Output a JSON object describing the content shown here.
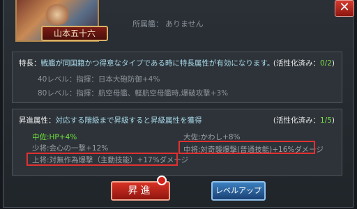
{
  "general": {
    "name": "山本五十六"
  },
  "affiliation": {
    "label": "所属艦：",
    "value": "ありません"
  },
  "trait": {
    "label": "特長：",
    "description": "戦艦が同国籍かつ得意なタイプである時に特長属性が有効になります。",
    "status_label": "(活性化済み：",
    "status_value": "0/2",
    "status_close": ")",
    "lines": [
      "40レベル：指揮：日本大砲防御+4%",
      "80レベル：指揮：航空母艦、軽航空母艦時,爆破攻撃+3%"
    ]
  },
  "promotion": {
    "label": "昇進属性：",
    "description": "対応する階級まで昇級すると昇級属性を獲得",
    "status_label": "(活性化済み：",
    "status_value": "1/5",
    "status_close": ")",
    "attributes": [
      "中佐:HP+4%",
      "大佐:かわし+8%",
      "少将:会心の一撃+12%",
      "中将:対奇襲爆撃(普通技能)+16%ダメージ",
      "上将:対無作為爆撃（主動技能）+17%ダメージ"
    ]
  },
  "buttons": {
    "promote": "昇進",
    "level_up": "レベルアップ"
  },
  "colors": {
    "active": "#6fe13c",
    "highlight": "#e23131",
    "primary": "#c42a1f",
    "secondary": "#2a64a3"
  }
}
